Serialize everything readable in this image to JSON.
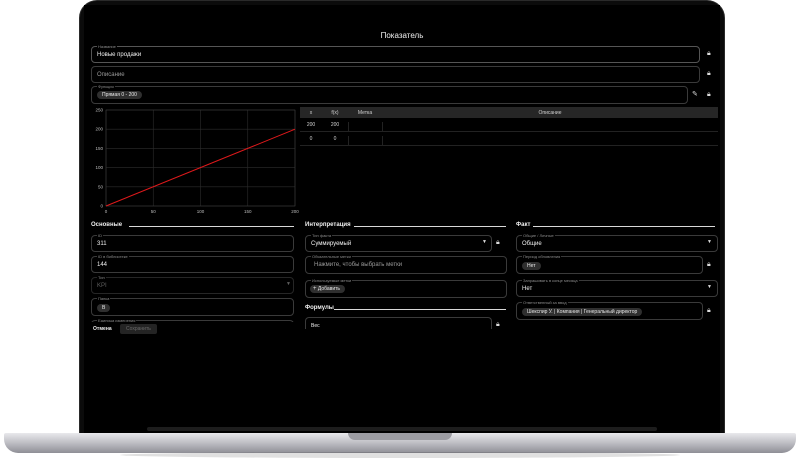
{
  "window": {
    "title": "Показатель"
  },
  "top": {
    "name": {
      "label": "Название",
      "value": "Новые продажи"
    },
    "description": {
      "placeholder": "Описание"
    },
    "function": {
      "label": "Функция",
      "chip": "Прямая 0 - 200"
    }
  },
  "table": {
    "headers": [
      "x",
      "f(x)",
      "Метка",
      "Описание"
    ],
    "rows": [
      [
        "200",
        "200",
        "",
        ""
      ],
      [
        "0",
        "0",
        "",
        ""
      ]
    ]
  },
  "chart_data": {
    "type": "line",
    "x": [
      0,
      200
    ],
    "y": [
      0,
      200
    ],
    "xlim": [
      0,
      200
    ],
    "ylim": [
      0,
      250
    ],
    "xticks": [
      "0",
      "50",
      "100",
      "150",
      "200"
    ],
    "yticks": [
      "0",
      "50",
      "100",
      "150",
      "200",
      "250"
    ],
    "grid": true,
    "line_color": "#e0191b"
  },
  "basic": {
    "section": "Основные",
    "id": {
      "label": "ID",
      "value": "311"
    },
    "lib_id": {
      "label": "ID в библиотеке",
      "value": "144"
    },
    "type": {
      "label": "Тип",
      "value": "KPI"
    },
    "folder": {
      "label": "Папка",
      "chip": "B"
    },
    "unit": {
      "label": "Единица измерения"
    }
  },
  "interpretation": {
    "section": "Интерпретация",
    "fact_type": {
      "label": "Тип факта",
      "value": "Суммируемый"
    },
    "required_tags": {
      "label": "Обязательные метки",
      "placeholder": "Нажмите, чтобы выбрать метки"
    },
    "used_tags": {
      "label": "Используемые метки",
      "add": "Добавить"
    }
  },
  "formulas": {
    "section": "Формулы",
    "field_value": "Вес"
  },
  "fact": {
    "section": "Факт",
    "scope": {
      "label": "Общие / Личные",
      "value": "Общие"
    },
    "period": {
      "label": "Период обновления",
      "chip": "Нет"
    },
    "month_end": {
      "label": "Запрашивать в конце месяца",
      "value": "Нет"
    },
    "responsible": {
      "label": "Ответственный за ввод",
      "chip": "Шекспир У. | Компания | Генеральный директор"
    }
  },
  "footer": {
    "cancel": "Отмена",
    "save": "Сохранить"
  },
  "colors": {
    "accent": "#e0191b",
    "background": "#000000"
  }
}
